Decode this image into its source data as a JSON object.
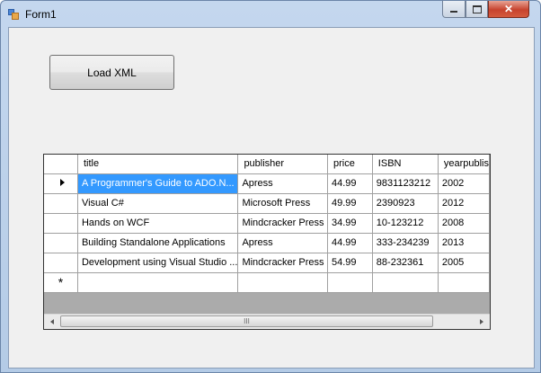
{
  "window": {
    "title": "Form1",
    "icon": "winforms-app-icon",
    "controls": {
      "minimize": "minimize-icon",
      "maximize": "maximize-icon",
      "close": "close-icon"
    }
  },
  "load_button": {
    "label": "Load XML"
  },
  "grid": {
    "columns": [
      "title",
      "publisher",
      "price",
      "ISBN",
      "yearpublis"
    ],
    "rows": [
      {
        "title": "A Programmer's Guide to ADO.N...",
        "publisher": "Apress",
        "price": "44.99",
        "isbn": "9831123212",
        "year": "2002"
      },
      {
        "title": "Visual C#",
        "publisher": "Microsoft Press",
        "price": "49.99",
        "isbn": "2390923",
        "year": "2012"
      },
      {
        "title": "Hands on WCF",
        "publisher": "Mindcracker Press",
        "price": "34.99",
        "isbn": "10-123212",
        "year": "2008"
      },
      {
        "title": "Building Standalone Applications",
        "publisher": "Apress",
        "price": "44.99",
        "isbn": "333-234239",
        "year": "2013"
      },
      {
        "title": "Development using Visual Studio ...",
        "publisher": "Mindcracker Press",
        "price": "54.99",
        "isbn": "88-232361",
        "year": "2005"
      }
    ],
    "current_row_marker": "current-row-arrow-icon",
    "new_row_marker": "*",
    "scroll_grip": "III"
  },
  "colors": {
    "selection": "#3399ff",
    "window_frame": "#b9d1ea",
    "client": "#f0f0f0",
    "grid_empty": "#ababab"
  }
}
